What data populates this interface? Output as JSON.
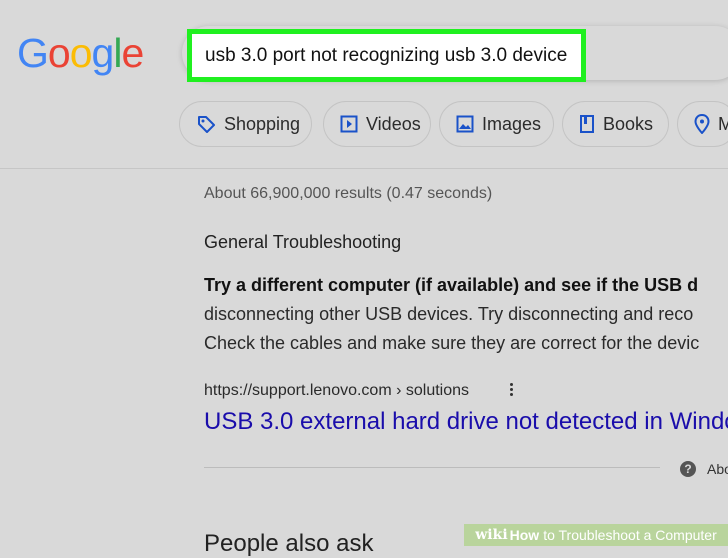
{
  "logo": {
    "letters": [
      "G",
      "o",
      "o",
      "g",
      "l",
      "e"
    ],
    "colors": [
      "#4285f4",
      "#ea4335",
      "#fbbc05",
      "#4285f4",
      "#34a853",
      "#ea4335"
    ]
  },
  "search": {
    "query": "usb 3.0 port not recognizing usb 3.0 device",
    "highlight_color": "#20f020"
  },
  "chips": [
    {
      "label": "Shopping",
      "icon": "tag-icon"
    },
    {
      "label": "Videos",
      "icon": "play-icon"
    },
    {
      "label": "Images",
      "icon": "image-icon"
    },
    {
      "label": "Books",
      "icon": "book-icon"
    },
    {
      "label": "M",
      "icon": "map-pin-icon"
    }
  ],
  "results": {
    "stats": "About 66,900,000 results (0.47 seconds)",
    "snippet_title": "General Troubleshooting",
    "snippet_bold": "Try a different computer (if available) and see if the USB d",
    "snippet_line2": "disconnecting other USB devices. Try disconnecting and reco",
    "snippet_line3": "Check the cables and make sure they are correct for the devic",
    "url": "https://support.lenovo.com › solutions",
    "link": "USB 3.0 external hard drive not detected in Windo",
    "about": "Abo",
    "paa": "People also ask"
  },
  "banner": {
    "wiki": "wiki",
    "how": "How",
    "rest": "to Troubleshoot a Computer"
  }
}
